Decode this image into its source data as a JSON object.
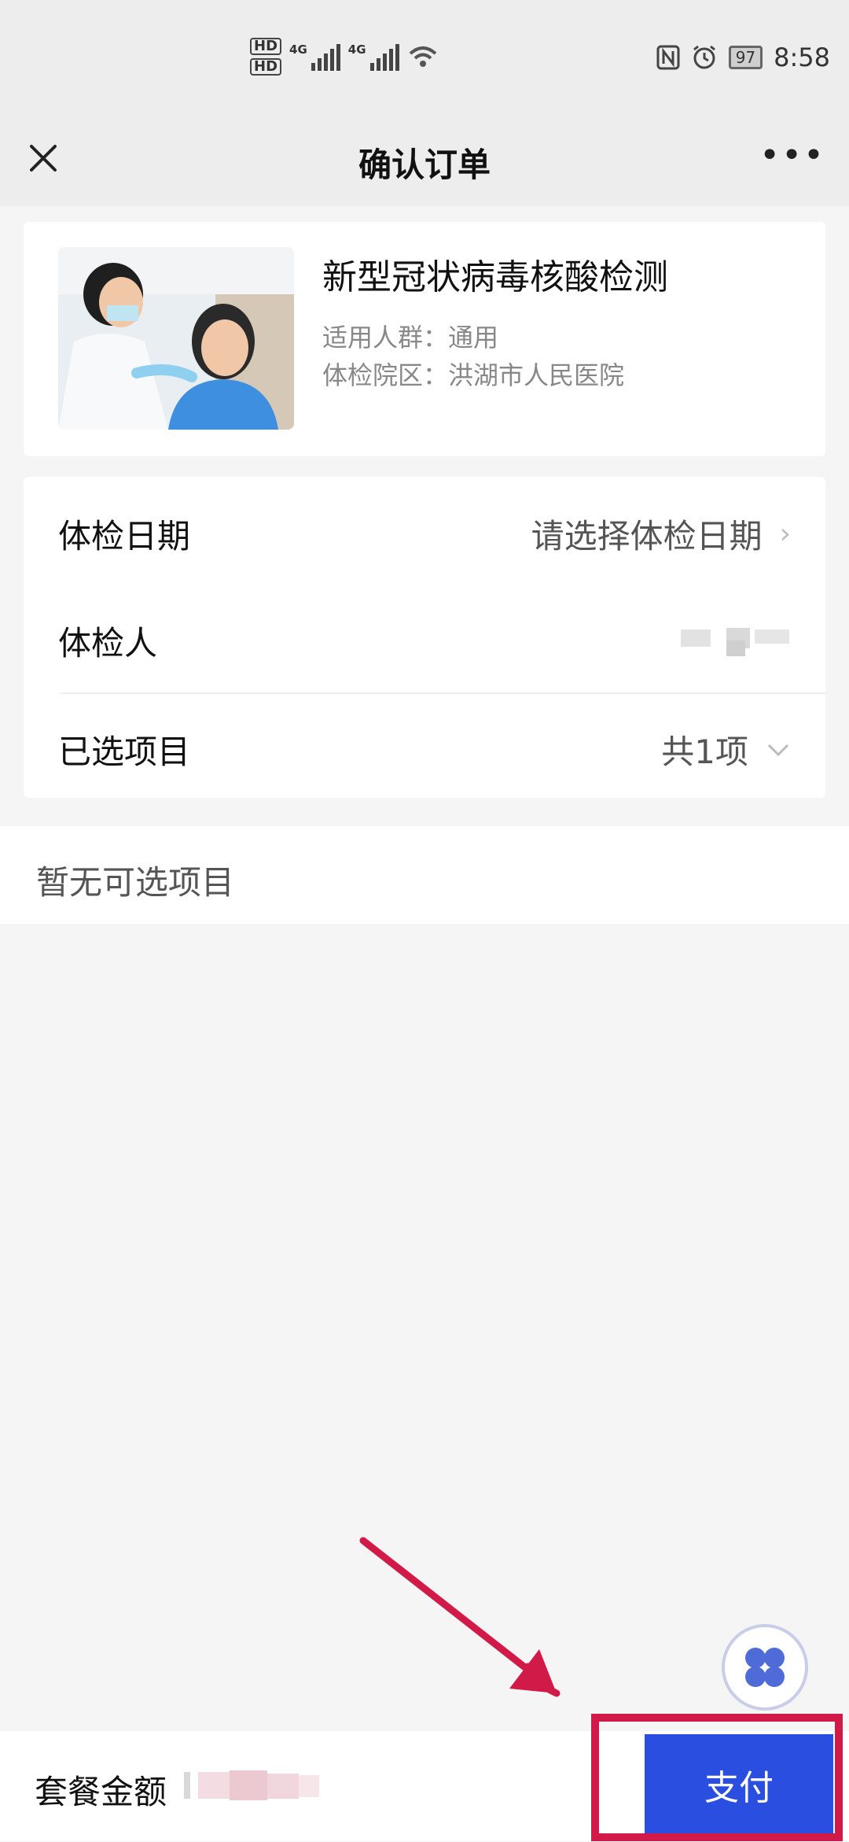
{
  "status_bar": {
    "hd1": "HD",
    "hd2": "HD",
    "net1": "4G",
    "net2": "4G",
    "battery": "97",
    "time": "8:58",
    "nfc_icon": "nfc-icon",
    "alarm_icon": "alarm-icon",
    "wifi_icon": "wifi-icon"
  },
  "nav": {
    "title": "确认订单",
    "close_icon": "close-icon",
    "more_icon": "more-icon",
    "more_glyph": "•••"
  },
  "product": {
    "name": "新型冠状病毒核酸检测",
    "meta_line1": "适用人群：通用",
    "meta_line2": "体检院区：洪湖市人民医院",
    "image": "dental-checkup-photo"
  },
  "info": {
    "date_label": "体检日期",
    "date_value": "请选择体检日期",
    "person_label": "体检人",
    "items_label": "已选项目",
    "items_value": "共1项"
  },
  "empty_note": "暂无可选项目",
  "bottom": {
    "total_label": "套餐金额",
    "pay_label": "支付"
  },
  "colors": {
    "accent": "#2a4ee0",
    "highlight": "#d11a48",
    "background": "#f5f5f5"
  }
}
